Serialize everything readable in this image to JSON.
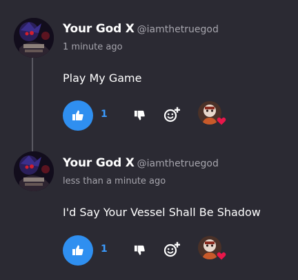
{
  "comments": [
    {
      "author": "Your God X",
      "handle": "@iamthetruegod",
      "time": "1 minute ago",
      "text": "Play My Game",
      "likes": "1",
      "reaction": "heart"
    },
    {
      "author": "Your God X",
      "handle": "@iamthetruegod",
      "time": "less than a minute ago",
      "text": "I'd Say Your Vessel Shall Be Shadow",
      "likes": "1",
      "reaction": "heart"
    }
  ],
  "colors": {
    "background": "#2b2a33",
    "accent": "#2f8ff0",
    "like_count": "#3b9bff",
    "muted_text": "#a6a5ad",
    "heart": "#e8174a"
  },
  "icons": {
    "like": "thumbs-up-icon",
    "dislike": "thumbs-down-icon",
    "react": "add-reaction-icon",
    "reaction": "heart-icon"
  }
}
